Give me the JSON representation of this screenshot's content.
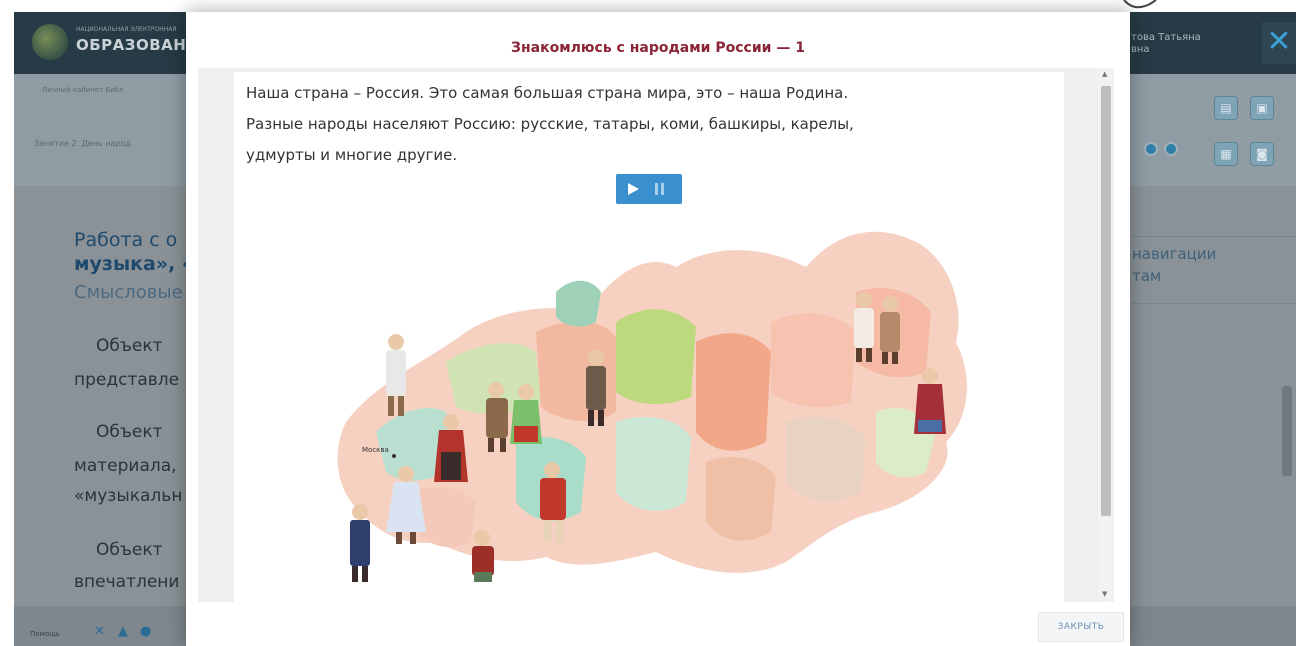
{
  "colors": {
    "modal_title": "#8a2438",
    "audio_button": "#3a8fcf",
    "header_bg": "#263b45"
  },
  "background_page": {
    "logo_small": "НАЦИОНАЛЬНАЯ ЭЛЕКТРОННАЯ",
    "logo_big": "ОБРАЗОВАНИ",
    "user_name_line1": "това Татьяна",
    "user_name_line2": "вна",
    "close_icon": "close-icon",
    "breadcrumb": "Личный кабинет     Библ",
    "lesson_label": "Занятие 2. День народ",
    "heading_line1": "Работа с о",
    "heading_line2": "музыка», «",
    "heading_sub": "Смысловые",
    "paragraphs": [
      "Объект ",
      "представле",
      "Объект ",
      "материала,",
      "«музыкальн",
      "Объект ",
      "впечатлени"
    ],
    "right_nav_line1": "навигации",
    "right_nav_line2": "там",
    "footer_help": "Помощь"
  },
  "modal": {
    "title": "Знакомлюсь с народами России — 1",
    "paragraph_lines": [
      "Наша страна – Россия. Это самая большая страна мира, это – наша Родина.",
      "Разные народы населяют Россию: русские, татары, коми, башкиры, карелы,",
      "удмурты и многие другие."
    ],
    "audio_play_icon": "play-icon",
    "audio_pause_icon": "pause-icon",
    "map_city_label": "Москва",
    "close_button": "ЗАКРЫТЬ"
  }
}
